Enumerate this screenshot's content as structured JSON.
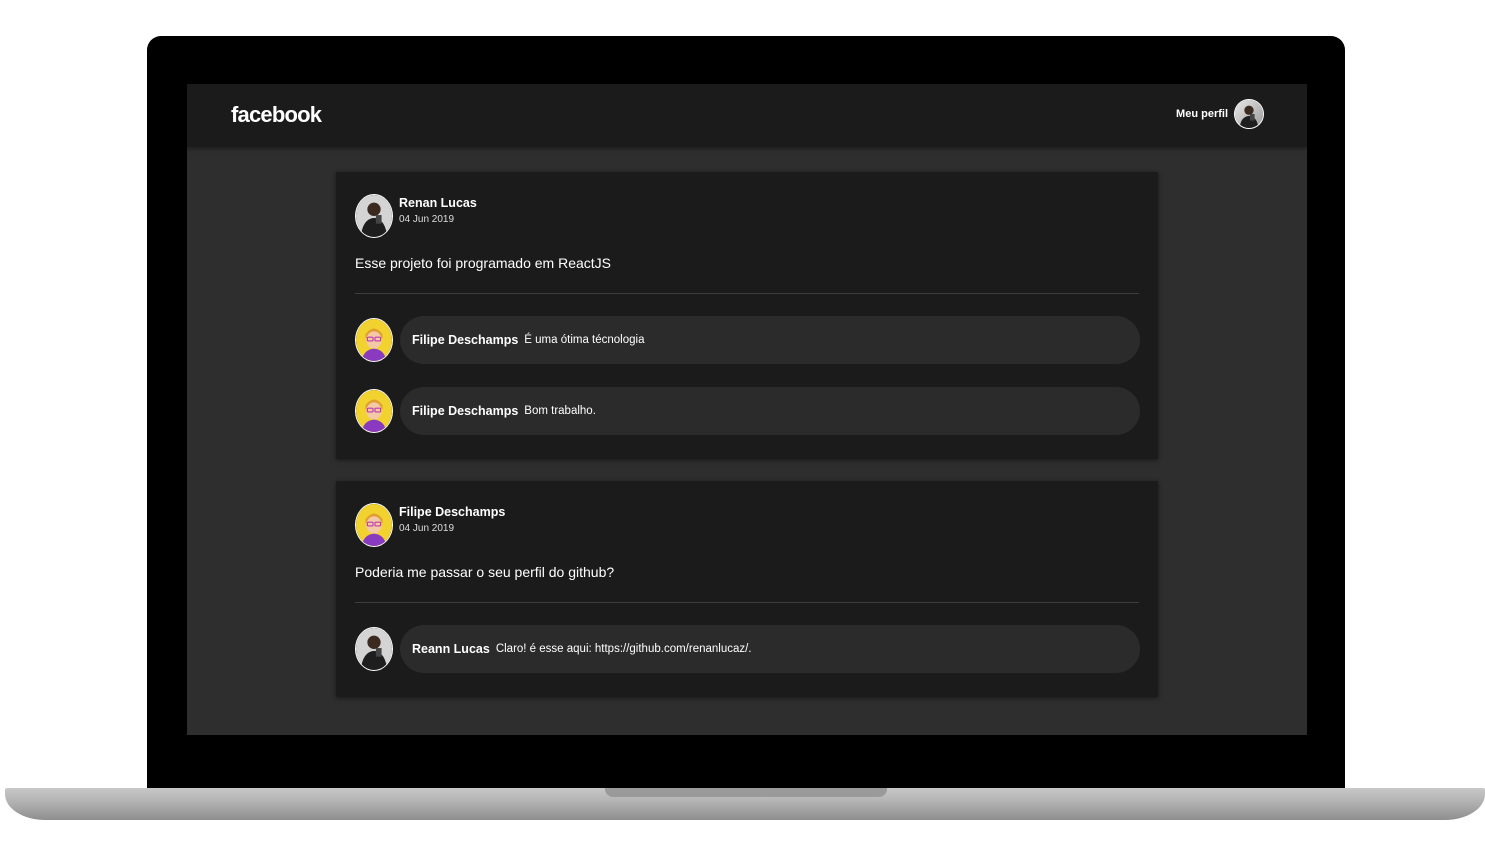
{
  "navbar": {
    "logo": "facebook",
    "profile_label": "Meu perfil",
    "profile_avatar_icon": "user-photo-avatar"
  },
  "posts": [
    {
      "author": "Renan Lucas",
      "date": "04 Jun 2019",
      "content": "Esse projeto foi programado em ReactJS",
      "avatar_icon": "user-photo-avatar",
      "comments": [
        {
          "author": "Filipe Deschamps",
          "text": "É uma ótima técnologia",
          "avatar_icon": "cartoon-avatar"
        },
        {
          "author": "Filipe Deschamps",
          "text": "Bom trabalho.",
          "avatar_icon": "cartoon-avatar"
        }
      ]
    },
    {
      "author": "Filipe Deschamps",
      "date": "04 Jun 2019",
      "content": "Poderia me passar o seu perfil do github?",
      "avatar_icon": "cartoon-avatar",
      "comments": [
        {
          "author": "Reann Lucas",
          "text": "Claro! é esse aqui: https://github.com/renanlucaz/.",
          "avatar_icon": "user-photo-avatar"
        }
      ]
    }
  ],
  "colors": {
    "background": "#2e2e2e",
    "card": "#1b1b1b",
    "comment_bubble": "#2b2b2b",
    "text": "#ffffff",
    "cartoon_avatar_bg": "#f2d22e"
  }
}
